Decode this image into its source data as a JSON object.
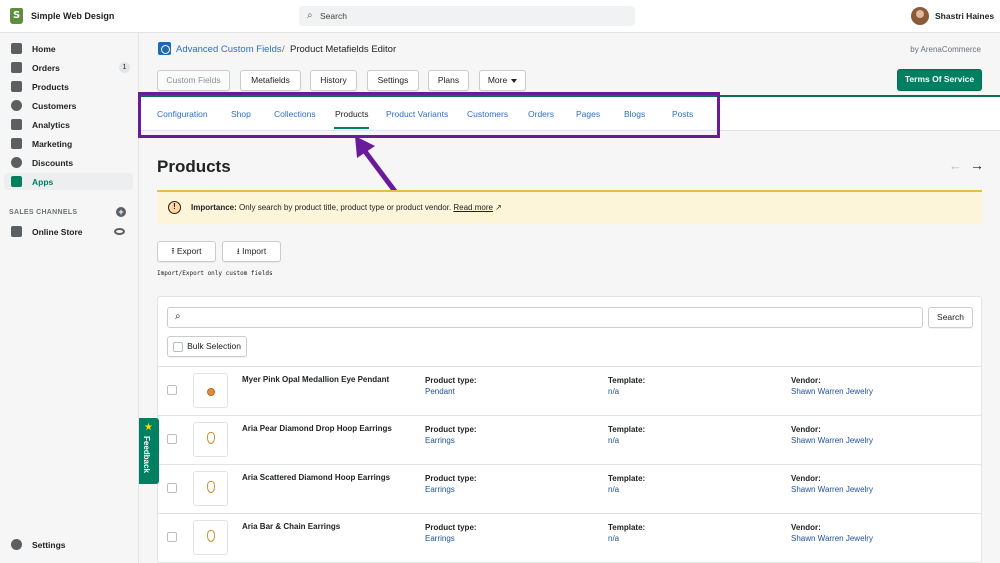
{
  "topbar": {
    "store_name": "Simple Web Design",
    "search_placeholder": "Search",
    "user_name": "Shastri Haines"
  },
  "sidebar": {
    "items": [
      {
        "label": "Home",
        "icon": "home-icon"
      },
      {
        "label": "Orders",
        "icon": "orders-icon",
        "badge": "1"
      },
      {
        "label": "Products",
        "icon": "tag-icon"
      },
      {
        "label": "Customers",
        "icon": "person-icon"
      },
      {
        "label": "Analytics",
        "icon": "analytics-icon"
      },
      {
        "label": "Marketing",
        "icon": "megaphone-icon"
      },
      {
        "label": "Discounts",
        "icon": "discount-icon"
      },
      {
        "label": "Apps",
        "icon": "apps-icon",
        "active": true
      }
    ],
    "sales_channels_header": "SALES CHANNELS",
    "online_store": "Online Store",
    "settings": "Settings"
  },
  "app_header": {
    "app_name": "Advanced Custom Fields",
    "separator": "/",
    "page_name": "Product Metafields Editor",
    "by_text": "by ArenaCommerce"
  },
  "toolbar": {
    "tabs": [
      "Custom Fields",
      "Metafields",
      "History",
      "Settings",
      "Plans",
      "More"
    ],
    "terms_button": "Terms Of Service"
  },
  "subtabs": [
    "Configuration",
    "Shop",
    "Collections",
    "Products",
    "Product Variants",
    "Customers",
    "Orders",
    "Pages",
    "Blogs",
    "Posts"
  ],
  "subtabs_active": "Products",
  "page": {
    "title": "Products",
    "prev_arrow": "←",
    "next_arrow": "→"
  },
  "banner": {
    "icon": "!",
    "label": "Importance:",
    "text": " Only search by product title, product type or product vendor. ",
    "link": "Read more",
    "external_icon": "↗"
  },
  "actions": {
    "export": "Export",
    "import": "Import",
    "helper": "Import/Export only custom fields"
  },
  "card": {
    "search_button": "Search",
    "bulk_selection": "Bulk Selection",
    "labels": {
      "type": "Product type:",
      "template": "Template:",
      "vendor": "Vendor:"
    },
    "products": [
      {
        "name": "Myer Pink Opal Medallion Eye Pendant",
        "type": "Pendant",
        "template": "n/a",
        "vendor": "Shawn Warren Jewelry"
      },
      {
        "name": "Aria Pear Diamond Drop Hoop Earrings",
        "type": "Earrings",
        "template": "n/a",
        "vendor": "Shawn Warren Jewelry"
      },
      {
        "name": "Aria Scattered Diamond Hoop Earrings",
        "type": "Earrings",
        "template": "n/a",
        "vendor": "Shawn Warren Jewelry"
      },
      {
        "name": "Aria Bar & Chain Earrings",
        "type": "Earrings",
        "template": "n/a",
        "vendor": "Shawn Warren Jewelry"
      }
    ]
  },
  "feedback": {
    "label": "Feedback",
    "star": "★"
  },
  "colors": {
    "primary_green": "#008060",
    "link_blue": "#2c6ecb",
    "annotation_purple": "#6a1b9a",
    "banner_bg": "#fcf5d9"
  }
}
